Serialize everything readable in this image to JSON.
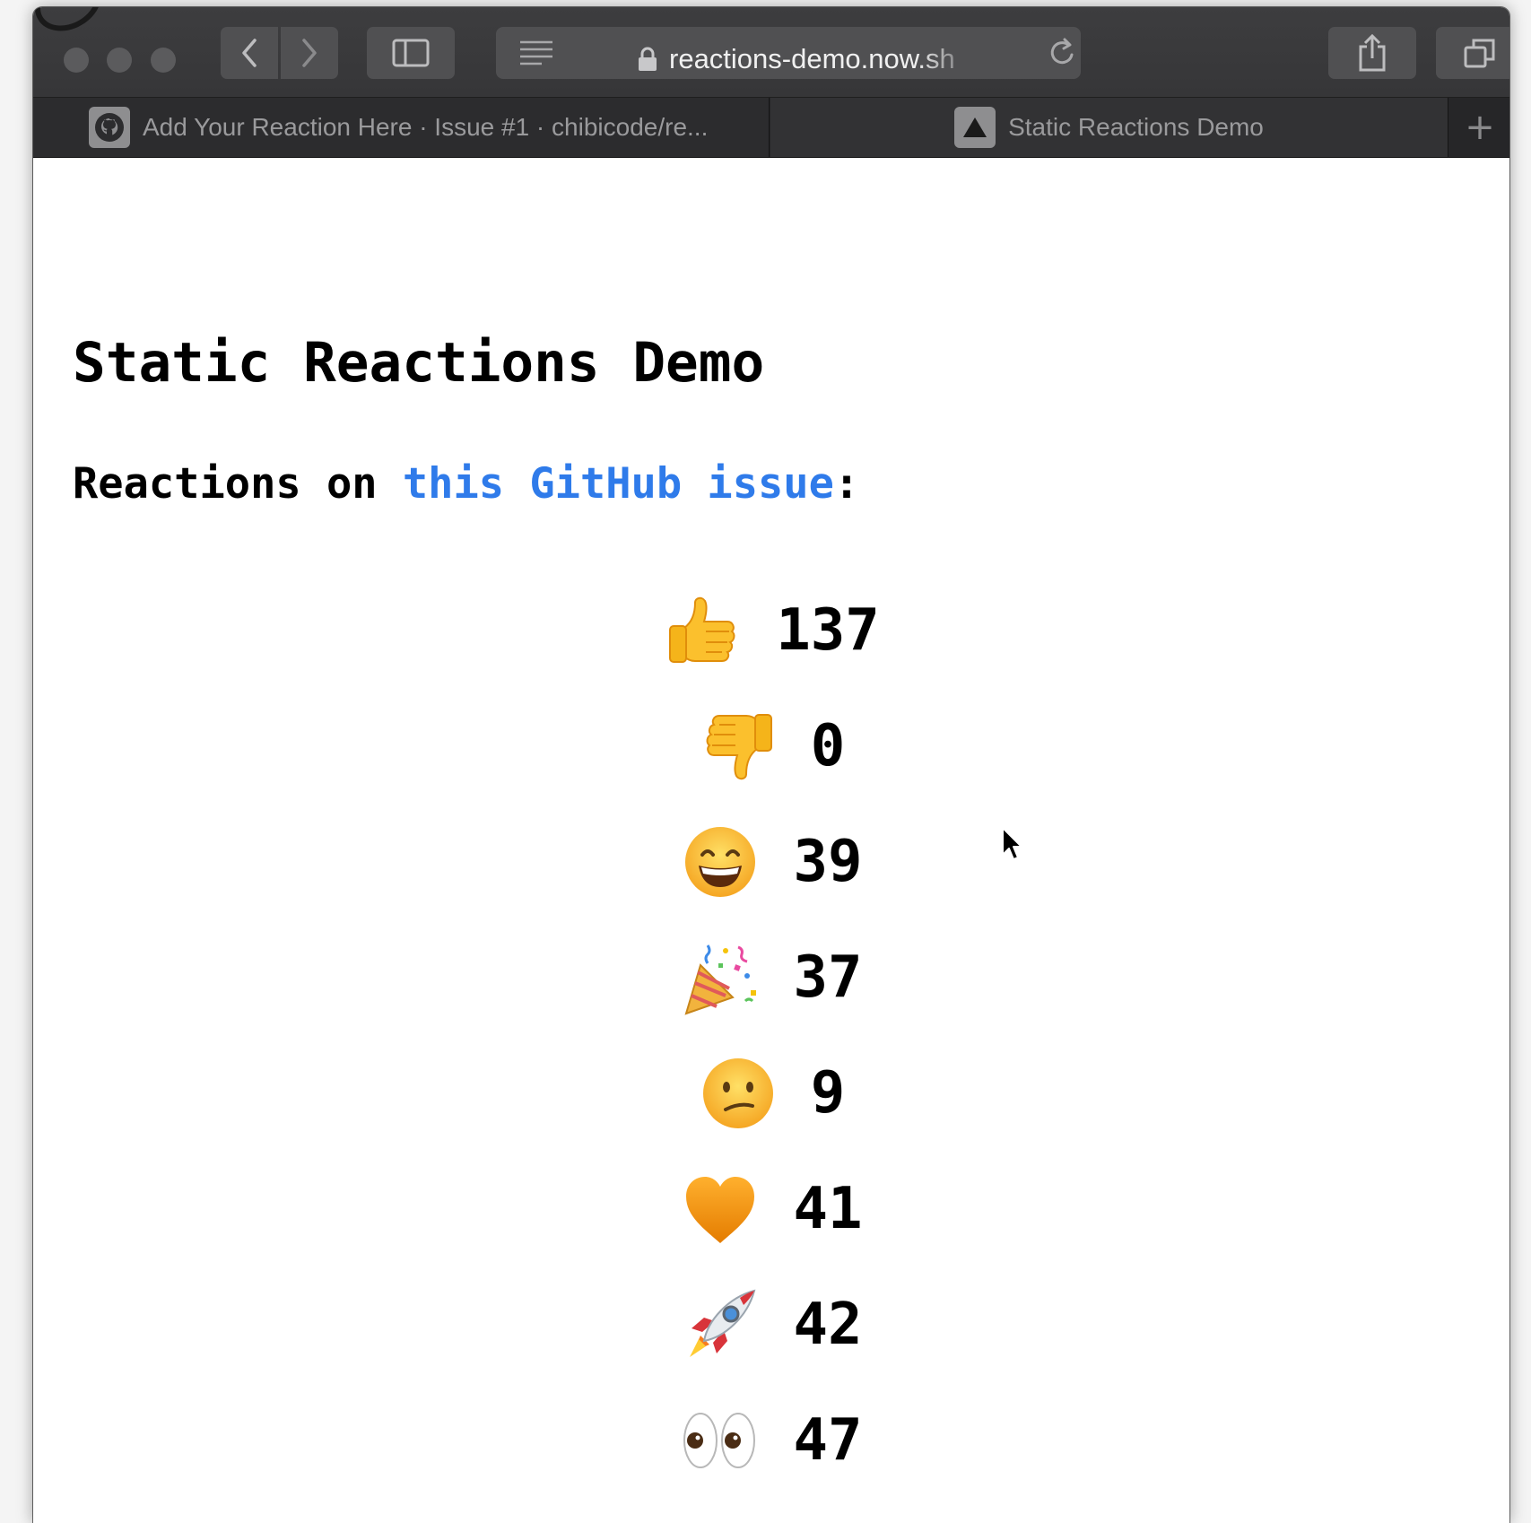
{
  "browser": {
    "url": "reactions-demo.now.sh",
    "tabs": [
      {
        "title": "Add Your Reaction Here · Issue #1 · chibicode/re...",
        "icon": "github-icon",
        "active": false
      },
      {
        "title": "Static Reactions Demo",
        "icon": "triangle-icon",
        "active": true
      }
    ],
    "new_tab_symbol": "+"
  },
  "page": {
    "title": "Static Reactions Demo",
    "subtitle_prefix": "Reactions on ",
    "subtitle_link": "this GitHub issue",
    "subtitle_suffix": ":",
    "reactions": [
      {
        "emoji": "👍",
        "name": "thumbs-up",
        "count": "137"
      },
      {
        "emoji": "👎",
        "name": "thumbs-down",
        "count": "0"
      },
      {
        "emoji": "😄",
        "name": "laugh",
        "count": "39"
      },
      {
        "emoji": "🎉",
        "name": "hooray",
        "count": "37"
      },
      {
        "emoji": "😕",
        "name": "confused",
        "count": "9"
      },
      {
        "emoji": "🧡",
        "name": "heart",
        "count": "41"
      },
      {
        "emoji": "🚀",
        "name": "rocket",
        "count": "42"
      },
      {
        "emoji": "👀",
        "name": "eyes",
        "count": "47"
      }
    ]
  },
  "colors": {
    "link": "#2f7bea",
    "toolbar": "#3d3d3f",
    "tabbar": "#262628"
  }
}
